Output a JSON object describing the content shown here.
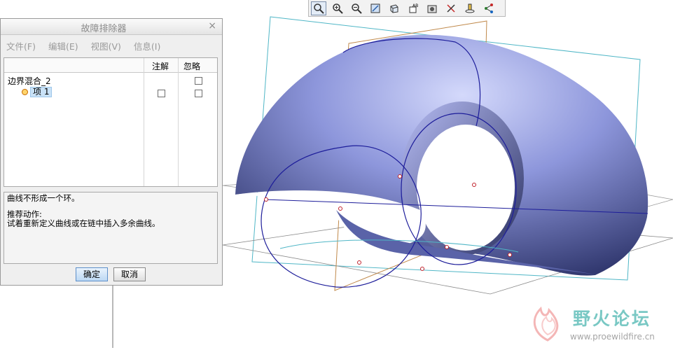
{
  "toolbar": {
    "icons": [
      "zoom-fit-icon",
      "zoom-in-icon",
      "zoom-out-icon",
      "refit-icon",
      "view-orientation-icon",
      "saved-views-icon",
      "shading-icon",
      "datum-display-icon",
      "spin-center-icon",
      "network-icon"
    ]
  },
  "dialog": {
    "title": "故障排除器",
    "close": "×",
    "menu": [
      "文件(F)",
      "编辑(E)",
      "视图(V)",
      "信息(I)"
    ],
    "columns": {
      "note": "注解",
      "ignore": "忽略"
    },
    "tree": {
      "root": "边界混合_2",
      "item": "项 1"
    },
    "message": {
      "line1": "曲线不形成一个环。",
      "line2": "推荐动作:",
      "line3": "试着重新定义曲线或在链中插入多余曲线。"
    },
    "buttons": {
      "ok": "确定",
      "cancel": "取消"
    }
  },
  "watermark": {
    "title": "野火论坛",
    "url": "www.proewildfire.cn"
  },
  "colors": {
    "surface": "#8f99dc",
    "curve": "#1d1d9a",
    "datum": "#4fb6c6",
    "brand": "#79c8c4"
  }
}
